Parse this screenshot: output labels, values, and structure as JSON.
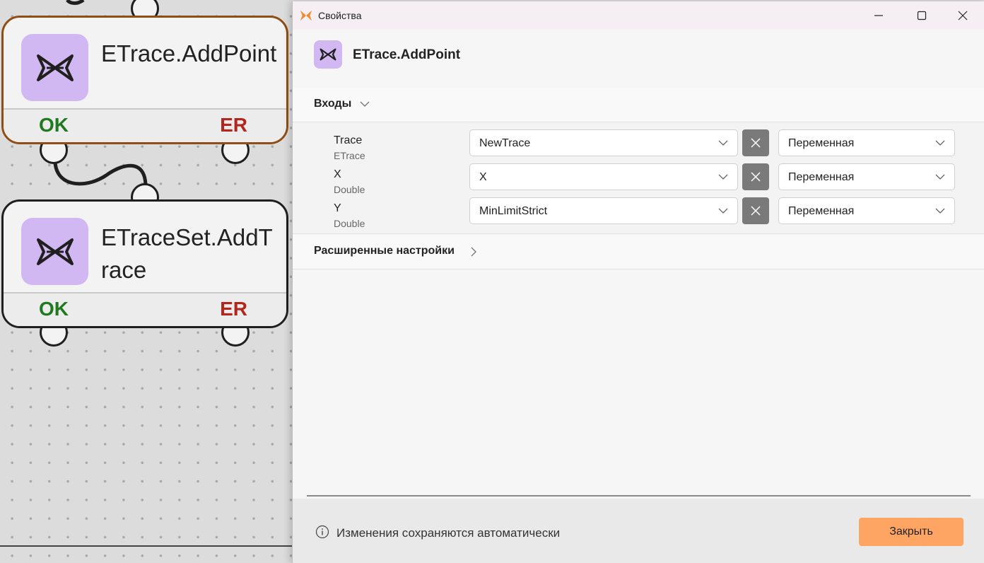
{
  "canvas": {
    "nodes": [
      {
        "title": "ETrace.AddPoint",
        "ok_label": "OK",
        "er_label": "ER",
        "selected": true
      },
      {
        "title": "ETraceSet.AddTrace",
        "ok_label": "OK",
        "er_label": "ER",
        "selected": false
      }
    ]
  },
  "dialog": {
    "window_title": "Свойства",
    "header_title": "ETrace.AddPoint",
    "inputs_section_label": "Входы",
    "params": [
      {
        "name": "Trace",
        "type": "ETrace",
        "value": "NewTrace",
        "mode": "Переменная"
      },
      {
        "name": "X",
        "type": "Double",
        "value": "X",
        "mode": "Переменная"
      },
      {
        "name": "Y",
        "type": "Double",
        "value": "MinLimitStrict",
        "mode": "Переменная"
      }
    ],
    "advanced_section_label": "Расширенные настройки",
    "footer_info": "Изменения сохраняются автоматически",
    "close_label": "Закрыть"
  },
  "colors": {
    "accent": "#ffa564",
    "node_icon_bg": "#d1b8f2",
    "ok": "#1f7a1f",
    "er": "#b3261e",
    "selected_border": "#8e4e14"
  }
}
